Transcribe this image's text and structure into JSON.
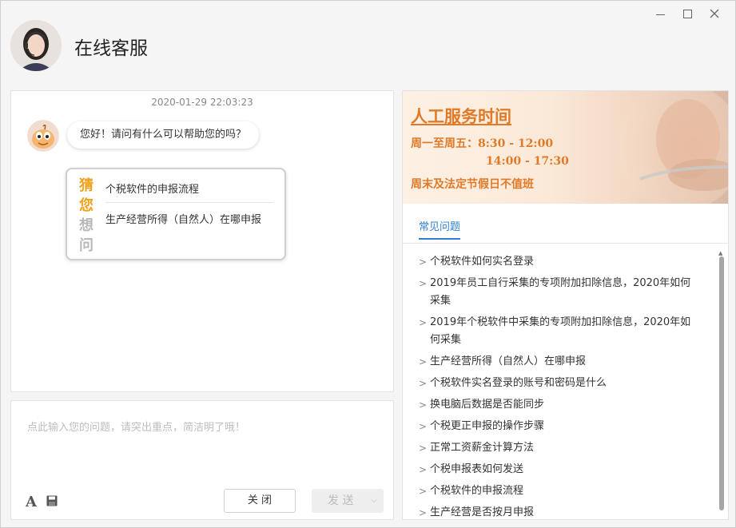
{
  "header": {
    "title": "在线客服"
  },
  "chat": {
    "timestamp": "2020-01-29 22:03:23",
    "greeting": "您好！请问有什么可以帮助您的吗？",
    "guess_tag": [
      "猜",
      "您",
      "想",
      "问"
    ],
    "guess_items": [
      "个税软件的申报流程",
      "生产经营所得（自然人）在哪申报"
    ]
  },
  "input": {
    "placeholder": "点此输入您的问题，请突出重点，简洁明了哦！",
    "font_tool": "A",
    "close_label": "关 闭",
    "send_label": "发 送"
  },
  "banner": {
    "title": "人工服务时间",
    "line1": "周一至周五：8:30 - 12:00",
    "line2": "14:00 - 17:30",
    "line3": "周末及法定节假日不值班"
  },
  "tabs": {
    "faq_label": "常见问题"
  },
  "faq": [
    "个税软件如何实名登录",
    "2019年员工自行采集的专项附加扣除信息，2020年如何采集",
    "2019年个税软件中采集的专项附加扣除信息，2020年如何采集",
    "生产经营所得（自然人）在哪申报",
    "个税软件实名登录的账号和密码是什么",
    "换电脑后数据是否能同步",
    "个税更正申报的操作步骤",
    "正常工资薪金计算方法",
    "个税申报表如何发送",
    "个税软件的申报流程",
    "生产经营是否按月申报"
  ],
  "colors": {
    "accent": "#2f7fd1",
    "banner_text": "#e07a28",
    "guess_highlight": "#f0a21c"
  }
}
